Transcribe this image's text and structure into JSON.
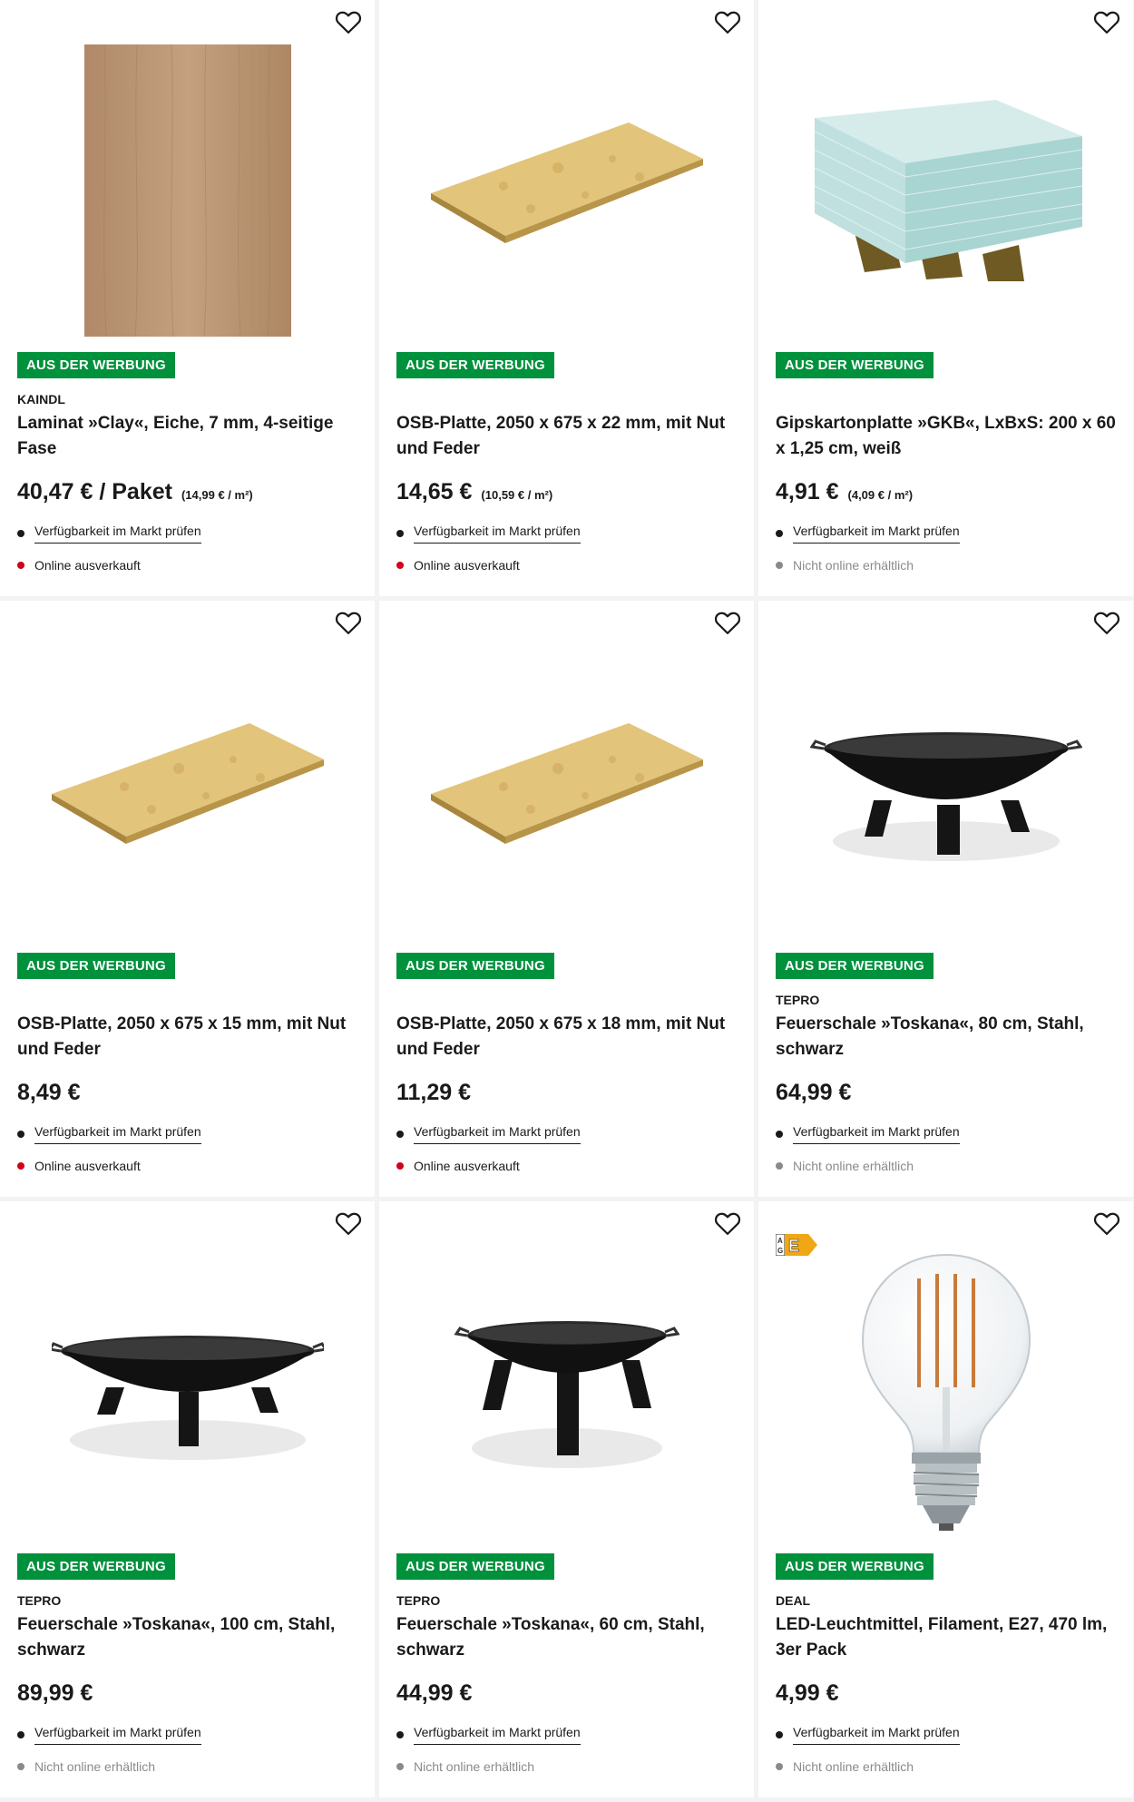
{
  "badge_label": "AUS DER WERBUNG",
  "availability_label": "Verfügbarkeit im Markt prüfen",
  "colors": {
    "badge": "#00913c",
    "sold_out": "#d0021b",
    "not_online": "#8a8a8a",
    "in_store": "#1a1a1a"
  },
  "products": [
    {
      "brand": "KAINDL",
      "title": "Laminat »Clay«, Eiche, 7 mm, 4-seitige Fase",
      "price": "40,47 € / Paket",
      "unit_price": "(14,99 € / m²)",
      "online_status": "Online ausverkauft",
      "image": "laminate-oak"
    },
    {
      "brand": "",
      "title": "OSB-Platte, 2050 x 675 x 22 mm, mit Nut und Feder",
      "price": "14,65 €",
      "unit_price": "(10,59 € / m²)",
      "online_status": "Online ausverkauft",
      "image": "osb-board"
    },
    {
      "brand": "",
      "title": "Gipskartonplatte »GKB«, LxBxS: 200 x 60 x 1,25 cm, weiß",
      "price": "4,91 €",
      "unit_price": "(4,09 € / m²)",
      "online_status": "Nicht online erhältlich",
      "image": "plasterboard-stack"
    },
    {
      "brand": "",
      "title": "OSB-Platte, 2050 x 675 x 15 mm, mit Nut und Feder",
      "price": "8,49 €",
      "unit_price": "",
      "online_status": "Online ausverkauft",
      "image": "osb-board"
    },
    {
      "brand": "",
      "title": "OSB-Platte, 2050 x 675 x 18 mm, mit Nut und Feder",
      "price": "11,29 €",
      "unit_price": "",
      "online_status": "Online ausverkauft",
      "image": "osb-board"
    },
    {
      "brand": "TEPRO",
      "title": "Feuerschale »Toskana«, 80 cm, Stahl, schwarz",
      "price": "64,99 €",
      "unit_price": "",
      "online_status": "Nicht online erhältlich",
      "image": "fire-bowl"
    },
    {
      "brand": "TEPRO",
      "title": "Feuerschale »Toskana«, 100 cm, Stahl, schwarz",
      "price": "89,99 €",
      "unit_price": "",
      "online_status": "Nicht online erhältlich",
      "image": "fire-bowl"
    },
    {
      "brand": "TEPRO",
      "title": "Feuerschale »Toskana«, 60 cm, Stahl, schwarz",
      "price": "44,99 €",
      "unit_price": "",
      "online_status": "Nicht online erhältlich",
      "image": "fire-bowl"
    },
    {
      "brand": "DEAL",
      "title": "LED-Leuchtmittel, Filament, E27, 470 lm, 3er Pack",
      "price": "4,99 €",
      "unit_price": "",
      "online_status": "Nicht online erhältlich",
      "image": "led-bulb",
      "energy_label": {
        "range_top": "A",
        "range_bottom": "G",
        "class": "E"
      }
    }
  ]
}
